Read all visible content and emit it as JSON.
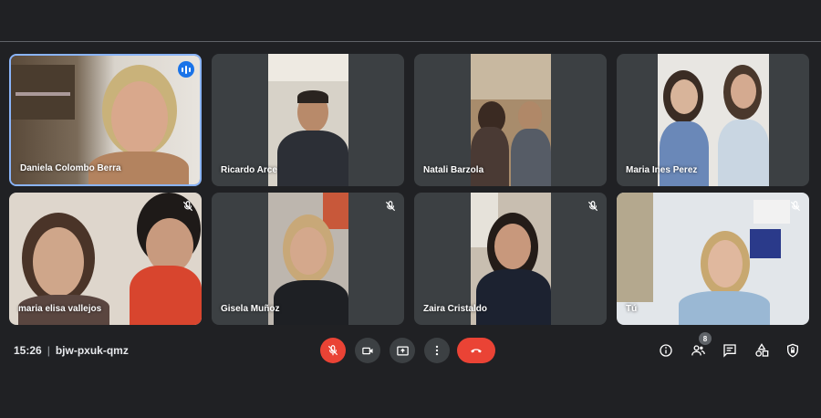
{
  "participants": [
    {
      "name": "Daniela Colombo Berra",
      "muted": false,
      "speaking": true
    },
    {
      "name": "Ricardo Arce",
      "muted": false,
      "speaking": false
    },
    {
      "name": "Natali Barzola",
      "muted": false,
      "speaking": false
    },
    {
      "name": "Maria Ines Perez",
      "muted": false,
      "speaking": false
    },
    {
      "name": "maria elisa vallejos",
      "muted": true,
      "speaking": false
    },
    {
      "name": "Gisela Muñoz",
      "muted": true,
      "speaking": false
    },
    {
      "name": "Zaira Cristaldo",
      "muted": true,
      "speaking": false
    },
    {
      "name": "Tú",
      "muted": true,
      "speaking": false
    }
  ],
  "meeting": {
    "time": "15:26",
    "code": "bjw-pxuk-qmz"
  },
  "controls": {
    "center": [
      "mic-off-icon",
      "camera-icon",
      "present-icon",
      "more-options-icon",
      "hang-up-icon"
    ],
    "right": [
      "info-icon",
      "people-icon",
      "chat-icon",
      "activities-icon",
      "host-controls-icon"
    ],
    "people_count": "8"
  },
  "colors": {
    "background": "#202124",
    "tile": "#3c4043",
    "danger": "#ea4335",
    "accent": "#1a73e8",
    "speaking_border": "#8ab4f8"
  }
}
